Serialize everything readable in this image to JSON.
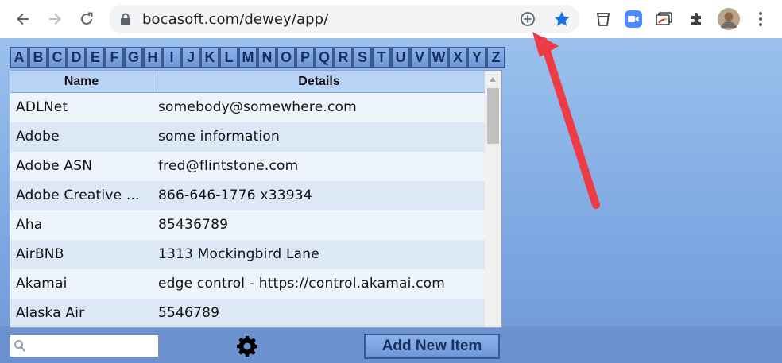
{
  "browser": {
    "url": "bocasoft.com/dewey/app/",
    "accent_color": "#1a73e8"
  },
  "letters": [
    "A",
    "B",
    "C",
    "D",
    "E",
    "F",
    "G",
    "H",
    "I",
    "J",
    "K",
    "L",
    "M",
    "N",
    "O",
    "P",
    "Q",
    "R",
    "S",
    "T",
    "U",
    "V",
    "W",
    "X",
    "Y",
    "Z"
  ],
  "table": {
    "columns": [
      "Name",
      "Details"
    ],
    "rows": [
      {
        "name": "ADLNet",
        "details": "somebody@somewhere.com"
      },
      {
        "name": "Adobe",
        "details": "some information"
      },
      {
        "name": "Adobe ASN",
        "details": "fred@flintstone.com"
      },
      {
        "name": "Adobe Creative ...",
        "details": "866-646-1776 x33934"
      },
      {
        "name": "Aha",
        "details": "85436789"
      },
      {
        "name": "AirBNB",
        "details": "1313 Mockingbird Lane"
      },
      {
        "name": "Akamai",
        "details": "edge control - https://control.akamai.com"
      },
      {
        "name": "Alaska Air",
        "details": "5546789"
      }
    ]
  },
  "footer": {
    "search_value": "",
    "add_button_label": "Add New Item"
  },
  "annotation": {
    "arrow_color": "#ee3b45"
  }
}
